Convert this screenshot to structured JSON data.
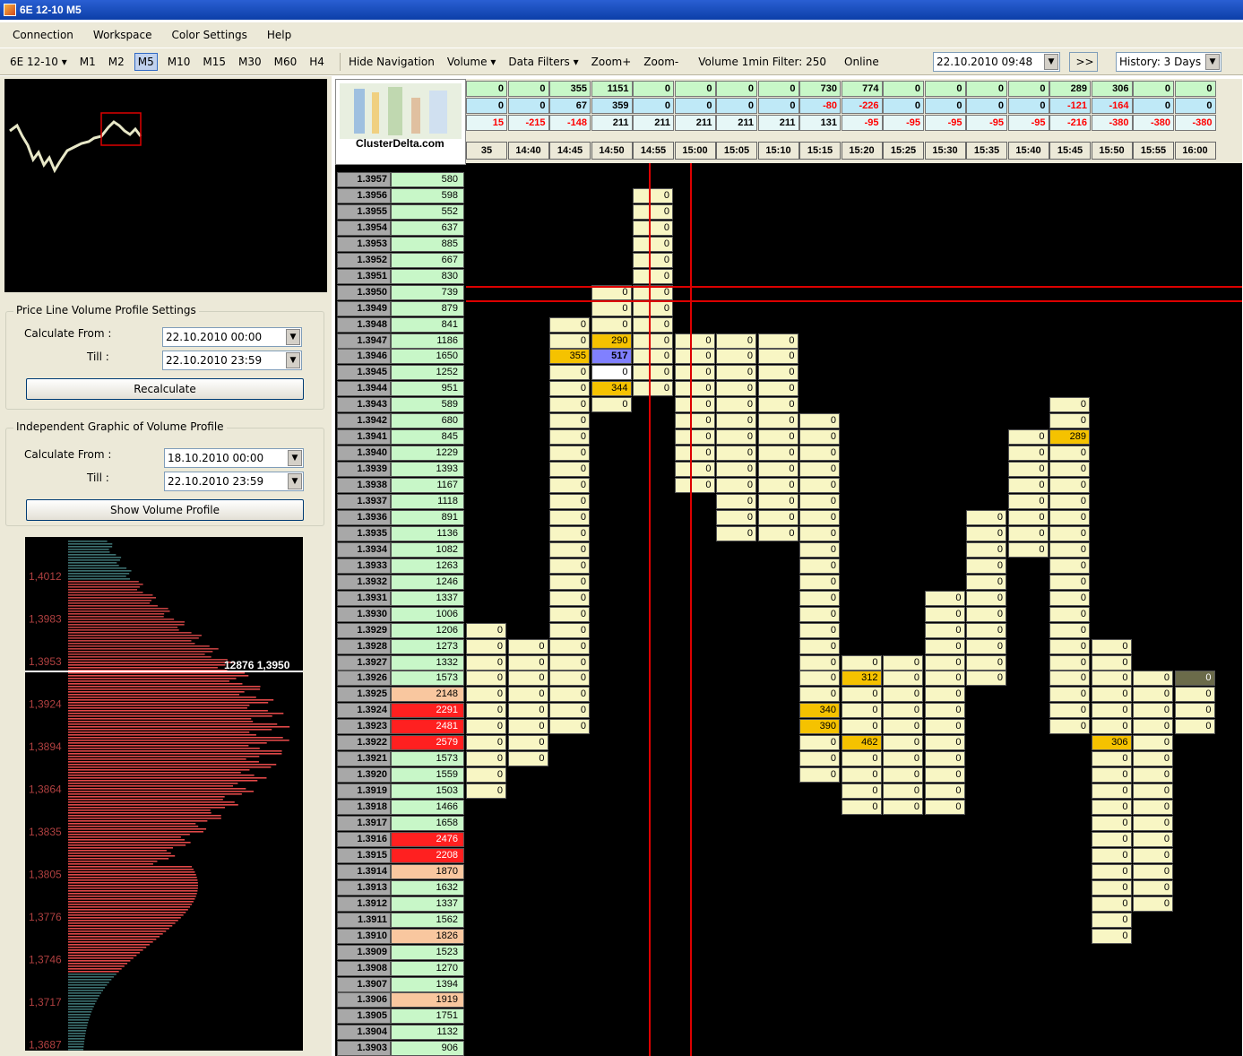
{
  "window": {
    "title": "6E 12-10 M5"
  },
  "menu": [
    "Connection",
    "Workspace",
    "Color Settings",
    "Help"
  ],
  "toolbar": {
    "symbol": "6E 12-10",
    "timeframes": [
      "M1",
      "M2",
      "M5",
      "M10",
      "M15",
      "M30",
      "M60",
      "H4"
    ],
    "active": "M5",
    "hide_nav": "Hide Navigation",
    "volume": "Volume",
    "filters": "Data Filters",
    "zoom_in": "Zoom+",
    "zoom_out": "Zoom-",
    "filter_text": "Volume 1min Filter: 250",
    "status": "Online",
    "datetime": "22.10.2010 09:48",
    "forward": ">>",
    "history": "History: 3 Days"
  },
  "plvp": {
    "title": "Price Line Volume Profile Settings",
    "from_label": "Calculate From :",
    "till_label": "Till :",
    "from": "22.10.2010 00:00",
    "till": "22.10.2010 23:59",
    "button": "Recalculate"
  },
  "igvp": {
    "title": "Independent Graphic of Volume Profile",
    "from_label": "Calculate From :",
    "till_label": "Till :",
    "from": "18.10.2010 00:00",
    "till": "22.10.2010 23:59",
    "button": "Show Volume Profile"
  },
  "profile": {
    "labels": [
      "1,4012",
      "1,3983",
      "1,3953",
      "1,3924",
      "1,3894",
      "1,3864",
      "1,3835",
      "1,3805",
      "1,3776",
      "1,3746",
      "1,3717",
      "1,3687"
    ],
    "marker_vol": "12876",
    "marker_price": "1,3950"
  },
  "logo": "ClusterDelta.com",
  "colors": {
    "grid_bg": "#000000",
    "price": "#a8a8a8",
    "vol": "#c8f7c8",
    "cell": "#f8f6c4",
    "hi": "#f5c200",
    "max": "#8080ff",
    "red": "#ff2020",
    "salmon": "#f9c79f",
    "line": "#d00000"
  },
  "header": {
    "row1": [
      "0",
      "0",
      "355",
      "1151",
      "0",
      "0",
      "0",
      "0",
      "730",
      "774",
      "0",
      "0",
      "0",
      "0",
      "289",
      "306",
      "0",
      "0"
    ],
    "row2": [
      "0",
      "0",
      "67",
      "359",
      "0",
      "0",
      "0",
      "0",
      "-80",
      "-226",
      "0",
      "0",
      "0",
      "0",
      "-121",
      "-164",
      "0",
      "0"
    ],
    "row3": [
      "15",
      "-215",
      "-148",
      "211",
      "211",
      "211",
      "211",
      "211",
      "131",
      "-95",
      "-95",
      "-95",
      "-95",
      "-95",
      "-216",
      "-380",
      "-380",
      "-380"
    ],
    "times": [
      "35",
      "14:40",
      "14:45",
      "14:50",
      "14:55",
      "15:00",
      "15:05",
      "15:10",
      "15:15",
      "15:20",
      "15:25",
      "15:30",
      "15:35",
      "15:40",
      "15:45",
      "15:50",
      "15:55",
      "16:00"
    ]
  },
  "prices": [
    "1.3957",
    "1.3956",
    "1.3955",
    "1.3954",
    "1.3953",
    "1.3952",
    "1.3951",
    "1.3950",
    "1.3949",
    "1.3948",
    "1.3947",
    "1.3946",
    "1.3945",
    "1.3944",
    "1.3943",
    "1.3942",
    "1.3941",
    "1.3940",
    "1.3939",
    "1.3938",
    "1.3937",
    "1.3936",
    "1.3935",
    "1.3934",
    "1.3933",
    "1.3932",
    "1.3931",
    "1.3930",
    "1.3929",
    "1.3928",
    "1.3927",
    "1.3926",
    "1.3925",
    "1.3924",
    "1.3923",
    "1.3922",
    "1.3921",
    "1.3920",
    "1.3919",
    "1.3918",
    "1.3917",
    "1.3916",
    "1.3915",
    "1.3914",
    "1.3913",
    "1.3912",
    "1.3911",
    "1.3910",
    "1.3909",
    "1.3908",
    "1.3907",
    "1.3906",
    "1.3905",
    "1.3904",
    "1.3903"
  ],
  "volumes": [
    "580",
    "598",
    "552",
    "637",
    "885",
    "667",
    "830",
    "739",
    "879",
    "841",
    "1186",
    "1650",
    "1252",
    "951",
    "589",
    "680",
    "845",
    "1229",
    "1393",
    "1167",
    "1118",
    "891",
    "1136",
    "1082",
    "1263",
    "1246",
    "1337",
    "1006",
    "1206",
    "1273",
    "1332",
    "1573",
    "2148",
    "2291",
    "2481",
    "2579",
    "1573",
    "1559",
    "1503",
    "1466",
    "1658",
    "2476",
    "2208",
    "1870",
    "1632",
    "1337",
    "1562",
    "1826",
    "1523",
    "1270",
    "1394",
    "1919",
    "1751",
    "1132",
    "906"
  ],
  "vol_colors": {
    "1.3925": "salmon",
    "1.3924": "red",
    "1.3923": "red",
    "1.3922": "red",
    "1.3916": "red",
    "1.3915": "red",
    "1.3914": "salmon",
    "1.3910": "salmon",
    "1.3906": "salmon"
  },
  "columns": [
    {
      "start": "1.3929",
      "end": "1.3919"
    },
    {
      "start": "1.3928",
      "end": "1.3921"
    },
    {
      "start": "1.3948",
      "end": "1.3923",
      "hi": {
        "1.3946": "355"
      }
    },
    {
      "start": "1.3950",
      "end": "1.3943",
      "hi": {
        "1.3947": "290",
        "1.3944": "344"
      },
      "max": {
        "1.3946": "517"
      },
      "white": [
        "1.3945"
      ]
    },
    {
      "start": "1.3956",
      "end": "1.3944"
    },
    {
      "start": "1.3947",
      "end": "1.3938"
    },
    {
      "start": "1.3947",
      "end": "1.3935"
    },
    {
      "start": "1.3947",
      "end": "1.3935"
    },
    {
      "start": "1.3942",
      "end": "1.3920",
      "hi": {
        "1.3924": "340",
        "1.3923": "390"
      }
    },
    {
      "start": "1.3927",
      "end": "1.3918",
      "hi": {
        "1.3926": "312",
        "1.3922": "462"
      }
    },
    {
      "start": "1.3927",
      "end": "1.3918"
    },
    {
      "start": "1.3931",
      "end": "1.3918"
    },
    {
      "start": "1.3936",
      "end": "1.3926"
    },
    {
      "start": "1.3941",
      "end": "1.3934"
    },
    {
      "start": "1.3943",
      "end": "1.3923",
      "hi": {
        "1.3941": "289"
      }
    },
    {
      "start": "1.3928",
      "end": "1.3910",
      "hi": {
        "1.3922": "306"
      }
    },
    {
      "start": "1.3926",
      "end": "1.3912"
    },
    {
      "start": "1.3926",
      "end": "1.3923",
      "dark": [
        "1.3926"
      ]
    }
  ]
}
